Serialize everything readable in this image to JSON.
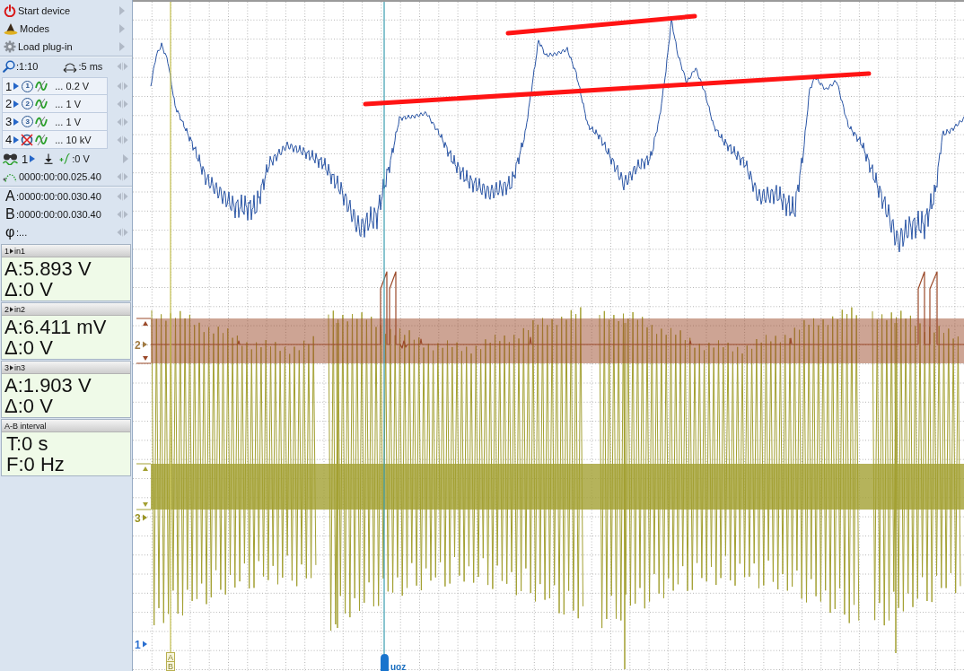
{
  "sidebar": {
    "menu": [
      {
        "kind": "power",
        "label": "Start device"
      },
      {
        "kind": "modes",
        "label": "Modes"
      },
      {
        "kind": "plugin",
        "label": "Load plug-in"
      }
    ],
    "zoom": {
      "scale": ":1:10",
      "timebase": ":5 ms"
    },
    "channels": [
      {
        "number": "1",
        "enabled": true,
        "badge": "1",
        "range": "... 0.2 V"
      },
      {
        "number": "2",
        "enabled": true,
        "badge": "2",
        "range": "... 1 V"
      },
      {
        "number": "3",
        "enabled": true,
        "badge": "3",
        "range": "... 1 V"
      },
      {
        "number": "4",
        "enabled": false,
        "range": "... 10 kV"
      }
    ],
    "trigger": {
      "channel": "1",
      "level": ":0 V"
    },
    "pretrigger": "0000:00:00.025.40",
    "cursor_times": [
      {
        "label": "A",
        "value": ":0000:00:00.030.40"
      },
      {
        "label": "B",
        "value": ":0000:00:00.030.40"
      },
      {
        "label": "φ",
        "value": ":..."
      }
    ],
    "readouts": [
      {
        "channel": "1",
        "title": "in1",
        "lines": [
          "A:5.893 V",
          "Δ:0 V"
        ]
      },
      {
        "channel": "2",
        "title": "in2",
        "lines": [
          "A:6.411 mV",
          "Δ:0 V"
        ]
      },
      {
        "channel": "3",
        "title": "in3",
        "lines": [
          "A:1.903 V",
          "Δ:0 V"
        ]
      },
      {
        "title": "A-B interval",
        "lines": [
          "T:0 s",
          "F:0 Hz"
        ]
      }
    ]
  },
  "scope": {
    "traces": [
      {
        "kind": "waveform",
        "color": "#2a55a5",
        "band": false
      },
      {
        "kind": "pulse_line",
        "color": "#9b4a2a",
        "band": true
      },
      {
        "kind": "spikes",
        "color": "#a3a032",
        "band": true
      }
    ],
    "channel_markers": [
      {
        "label": "2",
        "color": "#a07a42"
      },
      {
        "label": "3",
        "color": "#9a9424"
      },
      {
        "label": "1",
        "color": "#2a6fd0"
      }
    ],
    "ab_cursor": {
      "labels": [
        "A",
        "B"
      ]
    },
    "event_marker": {
      "label": "uoz"
    },
    "annotations": [
      {
        "kind": "trend_line"
      },
      {
        "kind": "trend_line"
      }
    ]
  }
}
